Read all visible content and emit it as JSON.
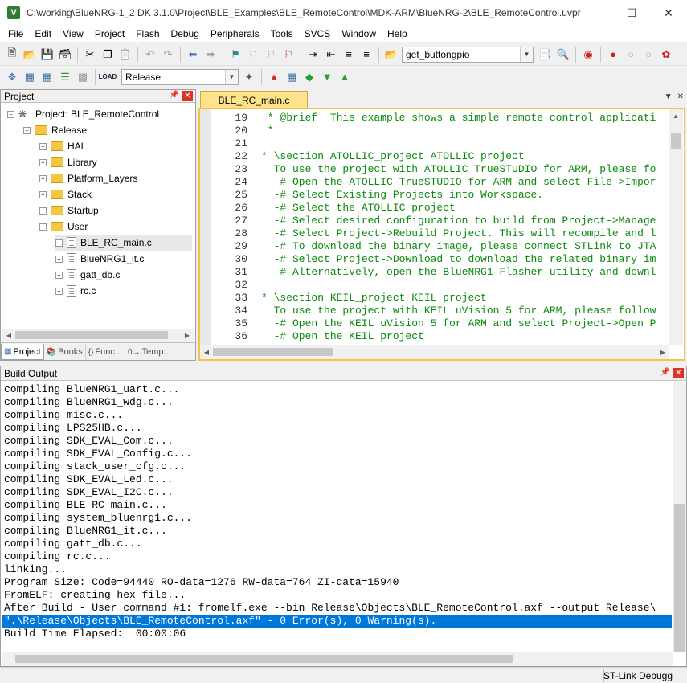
{
  "window": {
    "title": "C:\\working\\BlueNRG-1_2 DK 3.1.0\\Project\\BLE_Examples\\BLE_RemoteControl\\MDK-ARM\\BlueNRG-2\\BLE_RemoteControl.uvpr..."
  },
  "menu": [
    "File",
    "Edit",
    "View",
    "Project",
    "Flash",
    "Debug",
    "Peripherals",
    "Tools",
    "SVCS",
    "Window",
    "Help"
  ],
  "toolbar": {
    "find_combo_value": "get_buttongpio",
    "target_combo_value": "Release"
  },
  "project_panel": {
    "title": "Project",
    "root": "Project: BLE_RemoteControl",
    "target": "Release",
    "groups": [
      "HAL",
      "Library",
      "Platform_Layers",
      "Stack",
      "Startup",
      "User"
    ],
    "files": [
      "BLE_RC_main.c",
      "BlueNRG1_it.c",
      "gatt_db.c",
      "rc.c"
    ],
    "selected_file": "BLE_RC_main.c",
    "tabs": [
      {
        "label": "Project",
        "icon": "project-icon"
      },
      {
        "label": "Books",
        "icon": "books-icon"
      },
      {
        "label": "Func...",
        "icon": "functions-icon"
      },
      {
        "label": "Temp...",
        "icon": "templates-icon"
      }
    ]
  },
  "editor": {
    "tab_label": "BLE_RC_main.c",
    "line_numbers": [
      "19",
      "20",
      "21",
      "22",
      "23",
      "24",
      "25",
      "26",
      "27",
      "28",
      "29",
      "30",
      "31",
      "32",
      "33",
      "34",
      "35",
      "36"
    ],
    "lines": [
      " * @brief  This example shows a simple remote control applicati",
      " *",
      "",
      "* \\section ATOLLIC_project ATOLLIC project",
      "  To use the project with ATOLLIC TrueSTUDIO for ARM, please fo",
      "  -# Open the ATOLLIC TrueSTUDIO for ARM and select File->Impor",
      "  -# Select Existing Projects into Workspace.",
      "  -# Select the ATOLLIC project",
      "  -# Select desired configuration to build from Project->Manage",
      "  -# Select Project->Rebuild Project. This will recompile and l",
      "  -# To download the binary image, please connect STLink to JTA",
      "  -# Select Project->Download to download the related binary im",
      "  -# Alternatively, open the BlueNRG1 Flasher utility and downl",
      "",
      "* \\section KEIL_project KEIL project",
      "  To use the project with KEIL uVision 5 for ARM, please follow",
      "  -# Open the KEIL uVision 5 for ARM and select Project->Open P",
      "  -# Open the KEIL project"
    ],
    "code_color": "#0a8a0a"
  },
  "build_output": {
    "title": "Build Output",
    "lines": [
      "compiling BlueNRG1_uart.c...",
      "compiling BlueNRG1_wdg.c...",
      "compiling misc.c...",
      "compiling LPS25HB.c...",
      "compiling SDK_EVAL_Com.c...",
      "compiling SDK_EVAL_Config.c...",
      "compiling stack_user_cfg.c...",
      "compiling SDK_EVAL_Led.c...",
      "compiling SDK_EVAL_I2C.c...",
      "compiling BLE_RC_main.c...",
      "compiling system_bluenrg1.c...",
      "compiling BlueNRG1_it.c...",
      "compiling gatt_db.c...",
      "compiling rc.c...",
      "linking...",
      "Program Size: Code=94440 RO-data=1276 RW-data=764 ZI-data=15940",
      "FromELF: creating hex file...",
      "After Build - User command #1: fromelf.exe --bin Release\\Objects\\BLE_RemoteControl.axf --output Release\\",
      "\".\\Release\\Objects\\BLE_RemoteControl.axf\" - 0 Error(s), 0 Warning(s).",
      "Build Time Elapsed:  00:00:06"
    ],
    "highlighted_index": 18,
    "highlight_color": "#0078d7"
  },
  "status_bar": {
    "debugger": "ST-Link Debugg"
  }
}
